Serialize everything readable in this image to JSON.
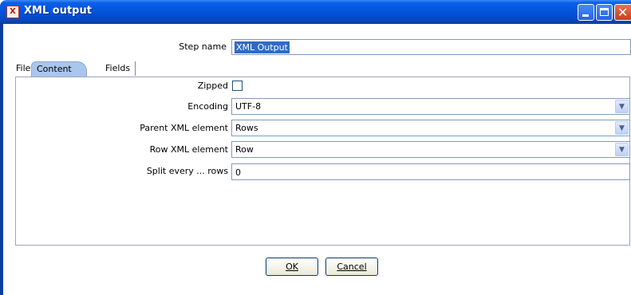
{
  "window": {
    "title": "XML output",
    "icon": "kettle-xml-icon",
    "title_icon_glyph": "XML"
  },
  "step": {
    "label": "Step name",
    "value": "XML Output"
  },
  "tabs": [
    {
      "label": "File",
      "active": false
    },
    {
      "label": "Content",
      "active": true
    },
    {
      "label": "Fields",
      "active": false
    }
  ],
  "content": {
    "zipped": {
      "label": "Zipped",
      "checked": false
    },
    "encoding": {
      "label": "Encoding",
      "value": "UTF-8"
    },
    "parent_element": {
      "label": "Parent XML element",
      "value": "Rows"
    },
    "row_element": {
      "label": "Row XML element",
      "value": "Row"
    },
    "split_rows": {
      "label": "Split every ... rows",
      "value": "0"
    }
  },
  "buttons": {
    "ok": "OK",
    "cancel": "Cancel"
  },
  "colors": {
    "titlebar": "#0454dc",
    "active_tab": "#a9c6ec",
    "selection": "#316ac5"
  }
}
